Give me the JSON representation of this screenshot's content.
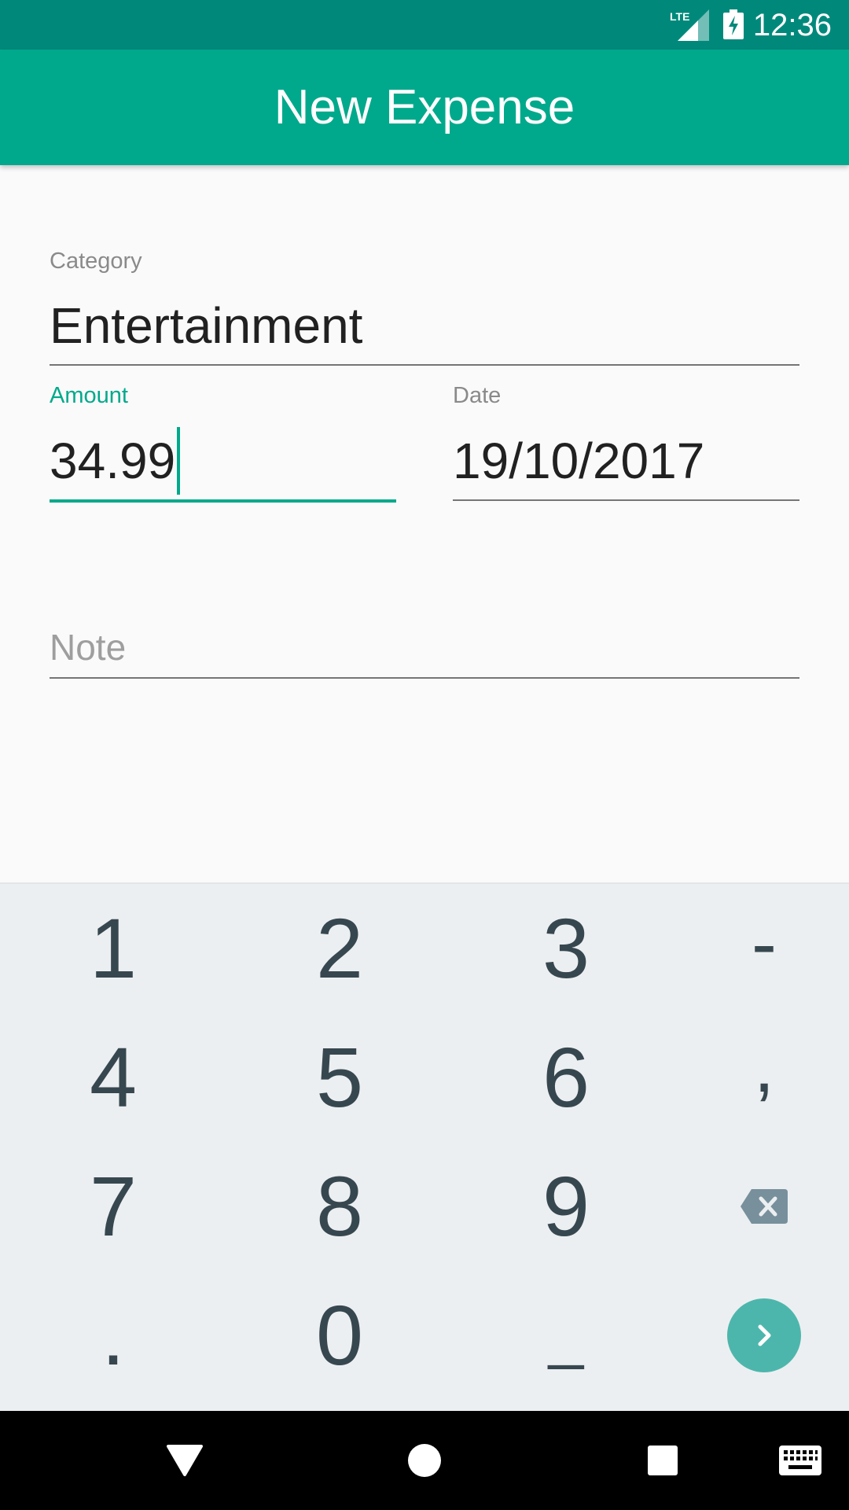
{
  "status_bar": {
    "network": "LTE",
    "time": "12:36"
  },
  "app_bar": {
    "title": "New Expense"
  },
  "form": {
    "category": {
      "label": "Category",
      "value": "Entertainment"
    },
    "amount": {
      "label": "Amount",
      "value": "34.99"
    },
    "date": {
      "label": "Date",
      "value": "19/10/2017"
    },
    "note": {
      "placeholder": "Note"
    }
  },
  "keyboard": {
    "rows": [
      [
        "1",
        "2",
        "3",
        "-"
      ],
      [
        "4",
        "5",
        "6",
        ","
      ],
      [
        "7",
        "8",
        "9",
        "backspace-icon"
      ],
      [
        ".",
        "0",
        "_",
        "next-icon"
      ]
    ]
  },
  "nav_bar": {
    "icons": [
      "back-icon",
      "home-icon",
      "recents-icon",
      "keyboard-icon"
    ]
  },
  "colors": {
    "status_bar": "#00897b",
    "app_bar": "#00a98b",
    "accent": "#00a98b",
    "fab": "#4db6ac",
    "keyboard_bg": "#eceff1",
    "key_text": "#37474f"
  }
}
